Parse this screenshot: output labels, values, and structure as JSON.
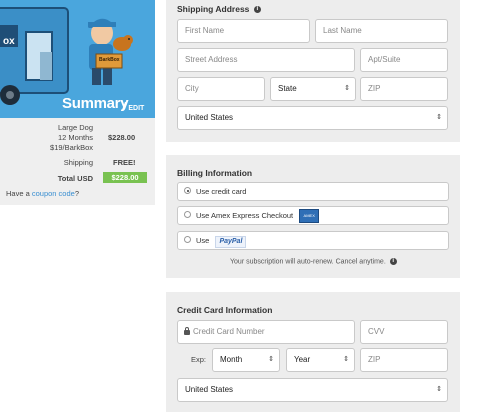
{
  "summary": {
    "title": "Summary",
    "edit_label": "EDIT",
    "plan_lines": [
      "Large Dog",
      "12 Months",
      "$19/BarkBox"
    ],
    "plan_price": "$228.00",
    "shipping_label": "Shipping",
    "shipping_value": "FREE!",
    "total_label": "Total USD",
    "total_value": "$228.00",
    "coupon_prefix": "Have a ",
    "coupon_link": "coupon code",
    "coupon_suffix": "?",
    "hero_text": "ox",
    "box_text": "BarkBox"
  },
  "shipping": {
    "title": "Shipping Address",
    "first_name": "First Name",
    "last_name": "Last Name",
    "street": "Street Address",
    "apt": "Apt/Suite",
    "city": "City",
    "state": "State",
    "zip": "ZIP",
    "country": "United States"
  },
  "billing": {
    "title": "Billing Information",
    "options": [
      "Use credit card",
      "Use Amex Express Checkout",
      "Use"
    ],
    "amex_badge": "AMEX",
    "paypal_badge": "PayPal",
    "note": "Your subscription will auto-renew. Cancel anytime."
  },
  "card": {
    "title": "Credit Card Information",
    "number": "Credit Card Number",
    "cvv": "CVV",
    "exp_label": "Exp:",
    "month": "Month",
    "year": "Year",
    "zip": "ZIP",
    "country": "United States"
  },
  "colors": {
    "hero_blue": "#4aa6dd",
    "total_green": "#79c251",
    "link_blue": "#3a8fd1"
  }
}
